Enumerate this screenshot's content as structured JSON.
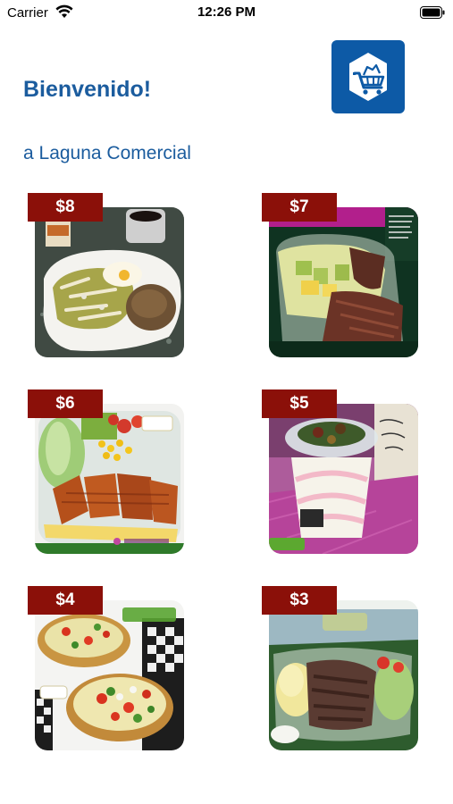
{
  "status_bar": {
    "carrier": "Carrier",
    "time": "12:26 PM"
  },
  "header": {
    "title": "Bienvenido!",
    "subtitle": "a Laguna Comercial",
    "logo_icon": "shopping-cart-bag-icon",
    "logo_color": "#0d5aa6"
  },
  "colors": {
    "accent": "#1b5c9e",
    "price_tag": "#8b1009"
  },
  "products": [
    {
      "price": "$8"
    },
    {
      "price": "$7"
    },
    {
      "price": "$6"
    },
    {
      "price": "$5"
    },
    {
      "price": "$4"
    },
    {
      "price": "$3"
    }
  ]
}
